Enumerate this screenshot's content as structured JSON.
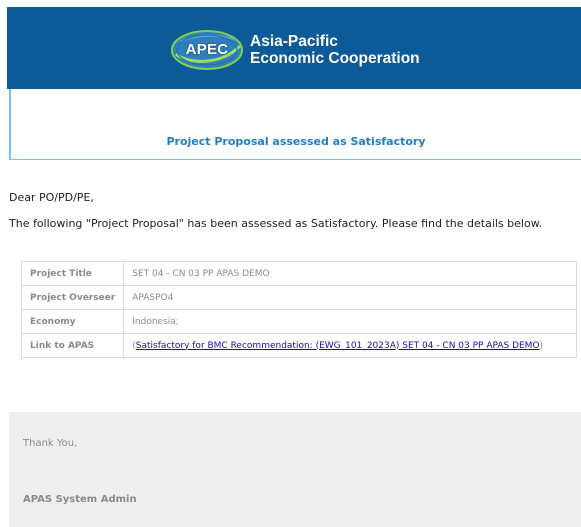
{
  "header": {
    "logo_text": "APEC",
    "org_line1": "Asia-Pacific",
    "org_line2": "Economic Cooperation",
    "brand_color": "#0d5a99"
  },
  "title": "Project Proposal assessed as Satisfactory",
  "greeting": "Dear PO/PD/PE,",
  "intro": "The following \"Project Proposal\" has been assessed as Satisfactory. Please find the details below.",
  "details": [
    {
      "label": "Project Title",
      "value": "SET 04 - CN 03 PP APAS DEMO"
    },
    {
      "label": "Project Overseer",
      "value": "APASPO4"
    },
    {
      "label": "Economy",
      "value": "Indonesia;"
    },
    {
      "label": "Link to APAS",
      "value": "Satisfactory for BMC Recommendation: (EWG_101_2023A) SET 04 - CN 03 PP APAS DEMO",
      "open": "(",
      "close": ")"
    }
  ],
  "footer": {
    "thanks": "Thank You,",
    "signature": "APAS System Admin"
  }
}
